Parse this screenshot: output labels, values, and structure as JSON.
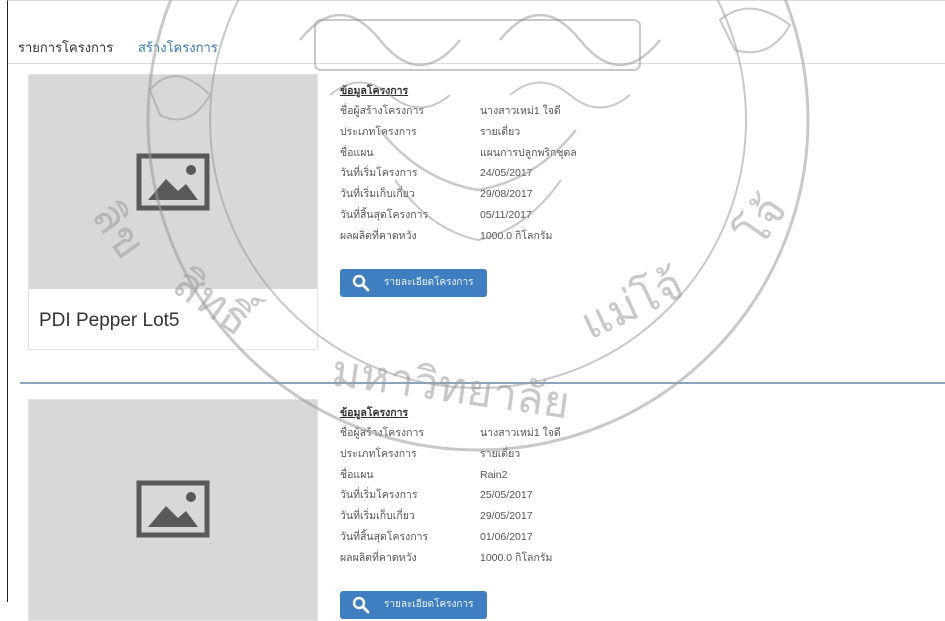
{
  "tabs": [
    {
      "label": "รายการโครงการ"
    },
    {
      "label": "สร้างโครงการ"
    }
  ],
  "projects": [
    {
      "title": "PDI Pepper Lot5",
      "info_heading": "ข้อมูลโครงการ",
      "fields": [
        {
          "label": "ชื่อผู้สร้างโครงการ",
          "value": "นางสาวเหม่1 ใจดี"
        },
        {
          "label": "ประเภทโครงการ",
          "value": "รายเดี่ยว"
        },
        {
          "label": "ชื่อแผน",
          "value": "แผนการปลูกพริกชุดล"
        },
        {
          "label": "วันที่เริ่มโครงการ",
          "value": "24/05/2017"
        },
        {
          "label": "วันที่เริ่มเก็บเกี่ยว",
          "value": "29/08/2017"
        },
        {
          "label": "วันที่สิ้นสุดโครงการ",
          "value": "05/11/2017"
        },
        {
          "label": "ผลผลิตที่คาดหวัง",
          "value": "1000.0  กิโลกรัม"
        }
      ],
      "button_label": "รายละเอียดโครงการ"
    },
    {
      "title": "",
      "info_heading": "ข้อมูลโครงการ",
      "fields": [
        {
          "label": "ชื่อผู้สร้างโครงการ",
          "value": "นางสาวเหม่1 ใจดี"
        },
        {
          "label": "ประเภทโครงการ",
          "value": "รายเดี่ยว"
        },
        {
          "label": "ชื่อแผน",
          "value": "Rain2"
        },
        {
          "label": "วันที่เริ่มโครงการ",
          "value": "25/05/2017"
        },
        {
          "label": "วันที่เริ่มเก็บเกี่ยว",
          "value": "29/05/2017"
        },
        {
          "label": "วันที่สิ้นสุดโครงการ",
          "value": "01/06/2017"
        },
        {
          "label": "ผลผลิตที่คาดหวัง",
          "value": "1000.0  กิโลกรัม"
        }
      ],
      "button_label": "รายละเอียดโครงการ"
    }
  ],
  "watermark": {
    "text": "ลิขสิทธิ์มหาวิทยาลัยแม่โจ้",
    "icon": "university-seal-watermark"
  },
  "colors": {
    "accent": "#3f7fc1",
    "tab_active_text": "#337ab7",
    "placeholder_bg": "#d8d8d8",
    "divider": "#8aa5bf"
  }
}
